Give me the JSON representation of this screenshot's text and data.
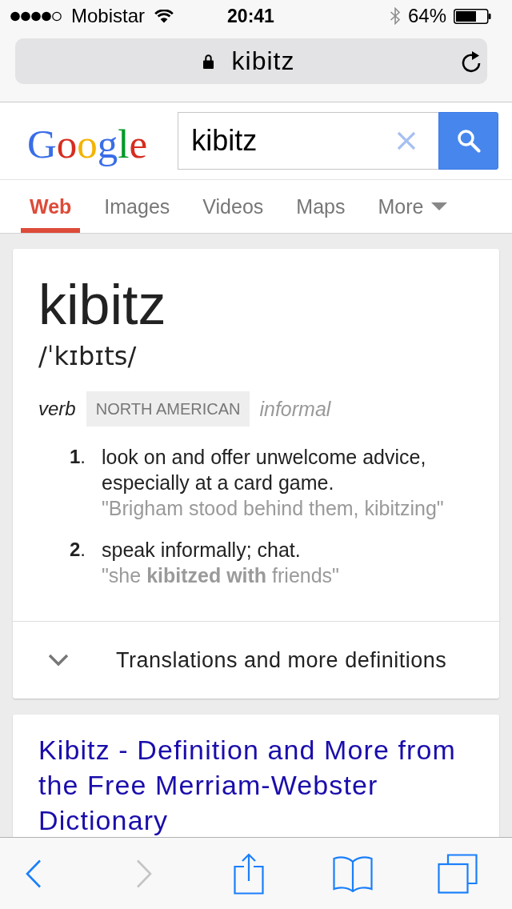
{
  "status_bar": {
    "carrier": "Mobistar",
    "time": "20:41",
    "battery": "64%"
  },
  "address_bar": {
    "text": "kibitz"
  },
  "search": {
    "logo": "Google",
    "value": "kibitz"
  },
  "tabs": [
    {
      "label": "Web",
      "selected": true,
      "kind": "link"
    },
    {
      "label": "Images",
      "selected": false,
      "kind": "link"
    },
    {
      "label": "Videos",
      "selected": false,
      "kind": "link"
    },
    {
      "label": "Maps",
      "selected": false,
      "kind": "link"
    },
    {
      "label": "More",
      "selected": false,
      "kind": "dropdown"
    }
  ],
  "definition_card": {
    "word": "kibitz",
    "pronunciation": "/ˈkɪbɪts/",
    "part_of_speech": "verb",
    "region": "NORTH AMERICAN",
    "register": "informal",
    "senses": [
      {
        "number": "**1**.",
        "text": "look on and offer unwelcome advice, especially at a card game.",
        "example": "\"Brigham stood behind them, kibitzing\""
      },
      {
        "number": "**2**.",
        "text": "speak informally; chat.",
        "example": "\"she **kibitzed with** friends\""
      }
    ],
    "more_link": {
      "label": "Translations and more definitions",
      "expanded": false
    }
  },
  "results": [
    {
      "title": "Kibitz - Definition and More from the Free Merriam-Webster Dictionary"
    }
  ],
  "toolbar": {
    "buttons": [
      {
        "kind": "back",
        "disabled": false
      },
      {
        "kind": "forward",
        "disabled": true
      },
      {
        "kind": "share",
        "disabled": false
      },
      {
        "kind": "bookmarks",
        "disabled": false
      },
      {
        "kind": "tabs",
        "disabled": false
      }
    ]
  }
}
